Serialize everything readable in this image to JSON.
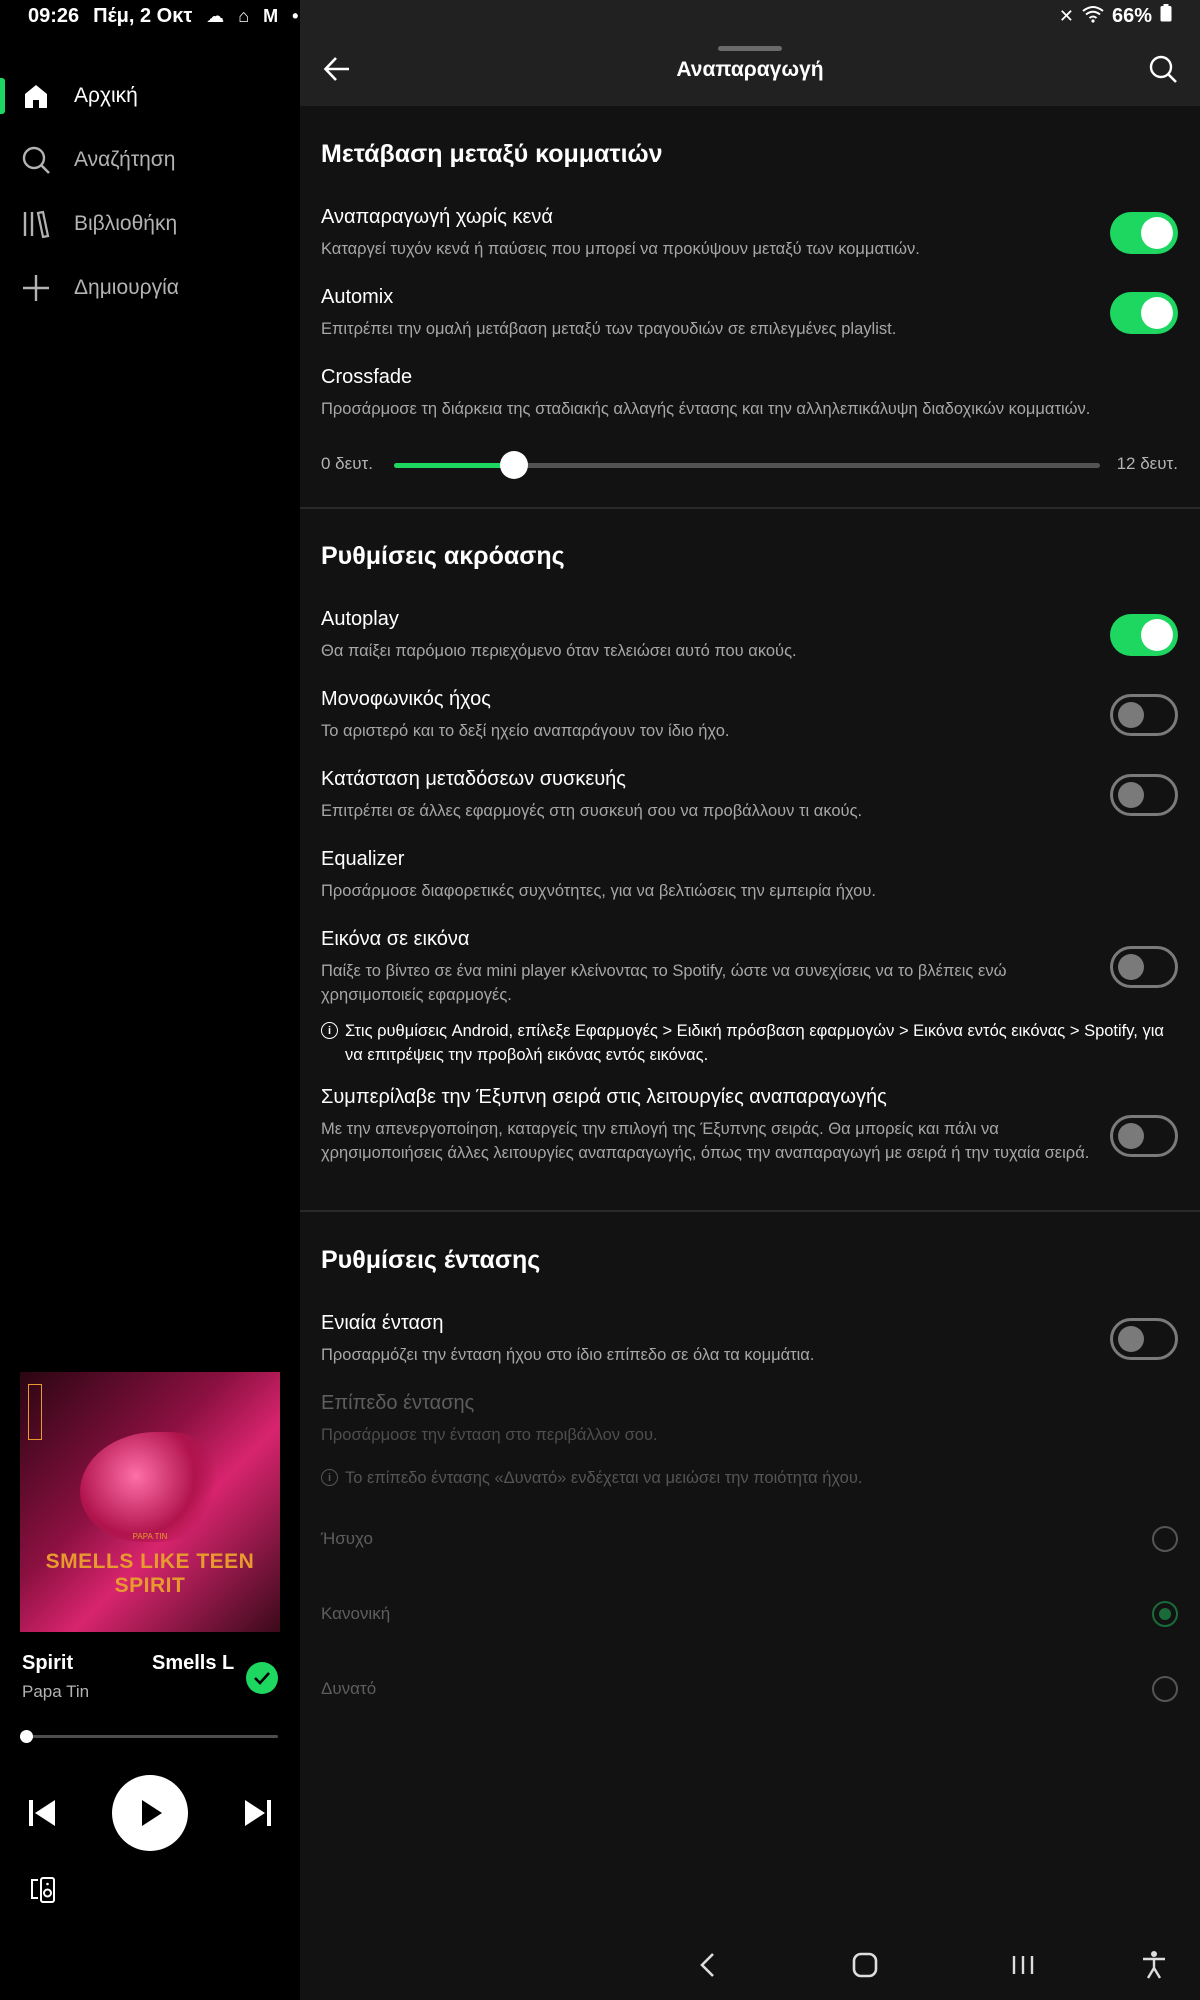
{
  "status_bar": {
    "time": "09:26",
    "date": "Πέμ, 2 Οκτ",
    "battery": "66%"
  },
  "sidebar": {
    "items": [
      {
        "label": "Αρχική",
        "icon": "home-icon",
        "active": true
      },
      {
        "label": "Αναζήτηση",
        "icon": "search-icon",
        "active": false
      },
      {
        "label": "Βιβλιοθήκη",
        "icon": "library-icon",
        "active": false
      },
      {
        "label": "Δημιουργία",
        "icon": "plus-icon",
        "active": false
      }
    ]
  },
  "now_playing": {
    "title_fragment": "Spirit",
    "title_next": "Smells L",
    "artist": "Papa Tin",
    "album_art_text": "SMELLS LIKE TEEN SPIRIT",
    "album_art_small": "PAPA TIN",
    "progress": 0.0
  },
  "header": {
    "title": "Αναπαραγωγή"
  },
  "sections": {
    "transitions": {
      "title": "Μετάβαση μεταξύ κομματιών",
      "gapless": {
        "title": "Αναπαραγωγή χωρίς κενά",
        "desc": "Καταργεί τυχόν κενά ή παύσεις που μπορεί να προκύψουν μεταξύ των κομματιών.",
        "on": true
      },
      "automix": {
        "title": "Automix",
        "desc": "Επιτρέπει την ομαλή μετάβαση μεταξύ των τραγουδιών σε επιλεγμένες playlist.",
        "on": true
      },
      "crossfade": {
        "title": "Crossfade",
        "desc": "Προσάρμοσε τη διάρκεια της σταδιακής αλλαγής έντασης και την αλληλεπικάλυψη διαδοχικών κομματιών.",
        "min_label": "0 δευτ.",
        "max_label": "12 δευτ.",
        "value_fraction": 0.17
      }
    },
    "listening": {
      "title": "Ρυθμίσεις ακρόασης",
      "autoplay": {
        "title": "Autoplay",
        "desc": "Θα παίξει παρόμοιο περιεχόμενο όταν τελειώσει αυτό που ακούς.",
        "on": true
      },
      "mono": {
        "title": "Μονοφωνικός ήχος",
        "desc": "Το αριστερό και το δεξί ηχείο αναπαράγουν τον ίδιο ήχο.",
        "on": false
      },
      "device_broadcast": {
        "title": "Κατάσταση μεταδόσεων συσκευής",
        "desc": "Επιτρέπει σε άλλες εφαρμογές στη συσκευή σου να προβάλλουν τι ακούς.",
        "on": false
      },
      "equalizer": {
        "title": "Equalizer",
        "desc": "Προσάρμοσε διαφορετικές συχνότητες, για να βελτιώσεις την εμπειρία ήχου."
      },
      "pip": {
        "title": "Εικόνα σε εικόνα",
        "desc": "Παίξε το βίντεο σε ένα mini player κλείνοντας το Spotify, ώστε να συνεχίσεις να το βλέπεις ενώ χρησιμοποιείς εφαρμογές.",
        "on": false,
        "note": "Στις ρυθμίσεις Android, επίλεξε Εφαρμογές > Ειδική πρόσβαση εφαρμογών > Εικόνα εντός εικόνας > Spotify, για να επιτρέψεις την προβολή εικόνας εντός εικόνας."
      },
      "smart_shuffle": {
        "title": "Συμπερίλαβε την Έξυπνη σειρά στις λειτουργίες αναπαραγωγής",
        "desc": "Με την απενεργοποίηση, καταργείς την επιλογή της Έξυπνης σειράς. Θα μπορείς και πάλι να χρησιμοποιήσεις άλλες λειτουργίες αναπαραγωγής, όπως την αναπαραγωγή με σειρά ή την τυχαία σειρά.",
        "on": false
      }
    },
    "volume": {
      "title": "Ρυθμίσεις έντασης",
      "normalize": {
        "title": "Ενιαία ένταση",
        "desc": "Προσαρμόζει την ένταση ήχου στο ίδιο επίπεδο σε όλα τα κομμάτια.",
        "on": false
      },
      "level": {
        "title": "Επίπεδο έντασης",
        "desc": "Προσάρμοσε την ένταση στο περιβάλλον σου.",
        "note": "Το επίπεδο έντασης «Δυνατό» ενδέχεται να μειώσει την ποιότητα ήχου."
      },
      "options": [
        "Ήσυχο",
        "Κανονική",
        "Δυνατό"
      ],
      "selected": "Κανονική"
    }
  },
  "colors": {
    "accent": "#1ed760",
    "background": "#121212",
    "header": "#212121",
    "sidebar": "#000000"
  }
}
